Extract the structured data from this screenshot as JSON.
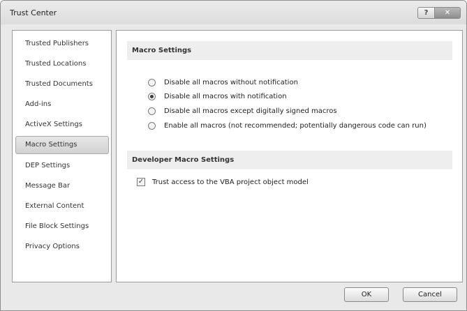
{
  "window": {
    "title": "Trust Center",
    "help_glyph": "?",
    "close_glyph": "✕"
  },
  "sidebar": {
    "items": [
      {
        "label": "Trusted Publishers",
        "selected": false
      },
      {
        "label": "Trusted Locations",
        "selected": false
      },
      {
        "label": "Trusted Documents",
        "selected": false
      },
      {
        "label": "Add-ins",
        "selected": false
      },
      {
        "label": "ActiveX Settings",
        "selected": false
      },
      {
        "label": "Macro Settings",
        "selected": true
      },
      {
        "label": "DEP Settings",
        "selected": false
      },
      {
        "label": "Message Bar",
        "selected": false
      },
      {
        "label": "External Content",
        "selected": false
      },
      {
        "label": "File Block Settings",
        "selected": false
      },
      {
        "label": "Privacy Options",
        "selected": false
      }
    ]
  },
  "macro_settings": {
    "header": "Macro Settings",
    "options": [
      {
        "label": "Disable all macros without notification",
        "checked": false
      },
      {
        "label": "Disable all macros with notification",
        "checked": true
      },
      {
        "label": "Disable all macros except digitally signed macros",
        "checked": false
      },
      {
        "label": "Enable all macros (not recommended; potentially dangerous code can run)",
        "checked": false
      }
    ]
  },
  "developer_settings": {
    "header": "Developer Macro Settings",
    "trust_vba_label": "Trust access to the VBA project object model",
    "trust_vba_checked": true,
    "check_glyph": "✓"
  },
  "buttons": {
    "ok": "OK",
    "cancel": "Cancel"
  }
}
